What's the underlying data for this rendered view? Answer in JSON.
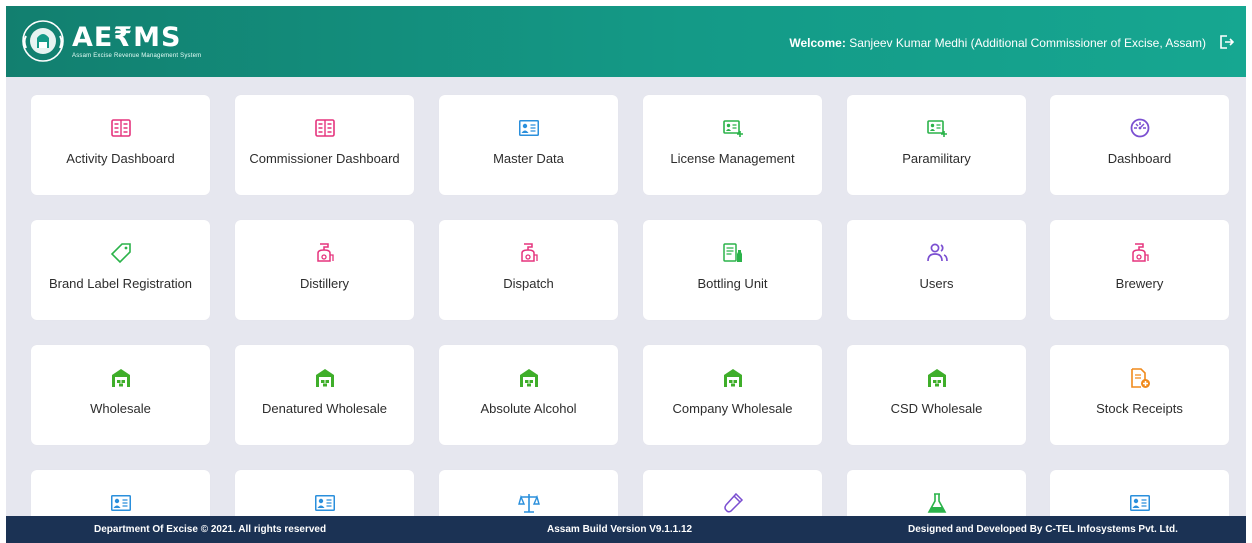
{
  "header": {
    "brand_title": "AE₹MS",
    "brand_subtitle": "Assam Excise Revenue Management System",
    "welcome_label": "Welcome:",
    "welcome_user": " Sanjeev Kumar Medhi (Additional Commissioner of Excise, Assam)",
    "logout_icon": "logout-icon"
  },
  "tiles": [
    {
      "label": "Activity Dashboard",
      "icon": "report-grid-icon",
      "color": "#e5337d"
    },
    {
      "label": "Commissioner Dashboard",
      "icon": "report-grid-icon",
      "color": "#e5337d"
    },
    {
      "label": "Master Data",
      "icon": "id-card-icon",
      "color": "#2a8fdc"
    },
    {
      "label": "License Management",
      "icon": "license-card-icon",
      "color": "#2bb34a"
    },
    {
      "label": "Paramilitary",
      "icon": "license-card-icon",
      "color": "#2bb34a"
    },
    {
      "label": "Dashboard",
      "icon": "clock-gauge-icon",
      "color": "#7b4fd1"
    },
    {
      "label": "Brand Label Registration",
      "icon": "tag-icon",
      "color": "#2bb34a"
    },
    {
      "label": "Distillery",
      "icon": "distillery-icon",
      "color": "#e5337d"
    },
    {
      "label": "Dispatch",
      "icon": "distillery-icon",
      "color": "#e5337d"
    },
    {
      "label": "Bottling Unit",
      "icon": "bottling-icon",
      "color": "#2bb34a"
    },
    {
      "label": "Users",
      "icon": "users-icon",
      "color": "#7b4fd1"
    },
    {
      "label": "Brewery",
      "icon": "distillery-icon",
      "color": "#e5337d"
    },
    {
      "label": "Wholesale",
      "icon": "warehouse-icon",
      "color": "#3fae2a"
    },
    {
      "label": "Denatured Wholesale",
      "icon": "warehouse-icon",
      "color": "#3fae2a"
    },
    {
      "label": "Absolute Alcohol",
      "icon": "warehouse-icon",
      "color": "#3fae2a"
    },
    {
      "label": "Company Wholesale",
      "icon": "warehouse-icon",
      "color": "#3fae2a"
    },
    {
      "label": "CSD Wholesale",
      "icon": "warehouse-icon",
      "color": "#3fae2a"
    },
    {
      "label": "Stock Receipts",
      "icon": "document-add-icon",
      "color": "#f08a1c"
    },
    {
      "label": "",
      "icon": "id-card-icon",
      "color": "#2a8fdc"
    },
    {
      "label": "",
      "icon": "id-card-icon",
      "color": "#2a8fdc"
    },
    {
      "label": "",
      "icon": "scales-icon",
      "color": "#2a8fdc"
    },
    {
      "label": "",
      "icon": "test-tube-icon",
      "color": "#7b4fd1"
    },
    {
      "label": "",
      "icon": "flask-icon",
      "color": "#2bb34a"
    },
    {
      "label": "",
      "icon": "id-card-icon",
      "color": "#2a8fdc"
    }
  ],
  "footer": {
    "copyright": "Department Of Excise © 2021. All rights reserved",
    "build": "Assam Build Version V9.1.1.12",
    "credits": "Designed and Developed By C-TEL Infosystems Pvt. Ltd."
  }
}
